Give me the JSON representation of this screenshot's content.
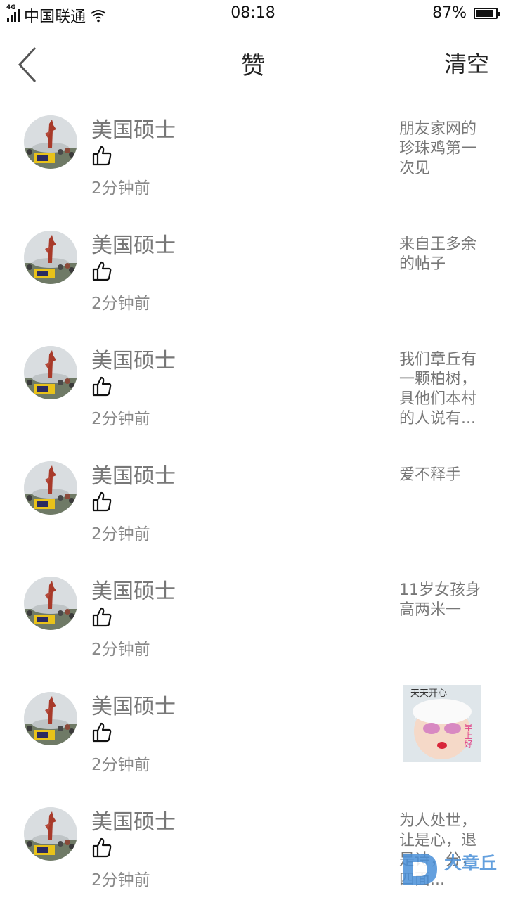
{
  "status_bar": {
    "carrier": "中国联通",
    "network": "4G",
    "time": "08:18",
    "battery": "87%",
    "battery_level": 0.87
  },
  "header": {
    "title": "赞",
    "clear_label": "清空",
    "back_icon": "chevron-left-icon"
  },
  "likes": [
    {
      "user": "美国硕士",
      "time": "2分钟前",
      "preview": "朋友家网的珍珠鸡第一次见"
    },
    {
      "user": "美国硕士",
      "time": "2分钟前",
      "preview": "来自王多余的帖子"
    },
    {
      "user": "美国硕士",
      "time": "2分钟前",
      "preview": "我们章丘有一颗柏树，具他们本村的人说有..."
    },
    {
      "user": "美国硕士",
      "time": "2分钟前",
      "preview": "爱不释手"
    },
    {
      "user": "美国硕士",
      "time": "2分钟前",
      "preview": "11岁女孩身高两米一"
    },
    {
      "user": "美国硕士",
      "time": "2分钟前",
      "preview": "",
      "thumbnail_text": [
        "天天开心",
        "早上好"
      ]
    },
    {
      "user": "美国硕士",
      "time": "2分钟前",
      "preview": "为人处世，让是心，退是诗，分，四面..."
    }
  ],
  "watermark": {
    "text": "大章丘"
  },
  "colors": {
    "background": "#ffffff",
    "text_primary": "#222222",
    "text_secondary": "#777777",
    "watermark": "#4a90d9"
  }
}
